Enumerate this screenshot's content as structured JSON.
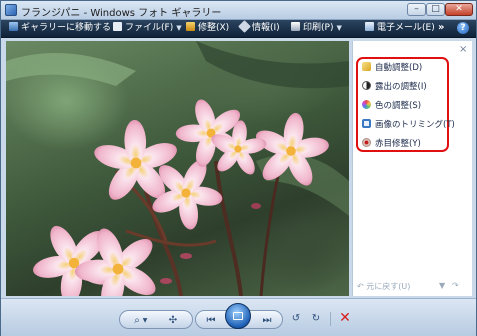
{
  "window": {
    "title": "フランジパニ - Windows フォト ギャラリー",
    "controls": {
      "minimize": "–",
      "maximize": "□",
      "close": "✕"
    }
  },
  "toolbar": {
    "items": [
      {
        "label": "ギャラリーに移動する",
        "icon": "gallery-icon"
      },
      {
        "label": "ファイル(F)",
        "icon": "file-icon",
        "has_menu": true
      },
      {
        "label": "修整(X)",
        "icon": "fix-icon"
      },
      {
        "label": "情報(I)",
        "icon": "info-tag-icon"
      },
      {
        "label": "印刷(P)",
        "icon": "print-icon",
        "has_menu": true
      },
      {
        "label": "電子メール(E)",
        "icon": "email-icon"
      }
    ],
    "more": "»",
    "help": "?"
  },
  "fix_panel": {
    "close": "×",
    "items": [
      {
        "label": "自動調整(D)",
        "icon": "auto-adjust-icon",
        "color": "#d9a421"
      },
      {
        "label": "露出の調整(I)",
        "icon": "exposure-icon",
        "color": "#333333"
      },
      {
        "label": "色の調整(S)",
        "icon": "color-icon",
        "color": "#d94a8c"
      },
      {
        "label": "画像のトリミング(T)",
        "icon": "crop-icon",
        "color": "#3a78c4"
      },
      {
        "label": "赤目修整(Y)",
        "icon": "red-eye-icon",
        "color": "#7a3a3a"
      }
    ],
    "undo": "元に戻す(U)",
    "redo_arrow": "↷"
  },
  "bottom_controls": {
    "zoom": "⌕",
    "fit": "✣",
    "previous": "⏮",
    "slideshow": "",
    "next": "⏭",
    "rotate_ccw": "↺",
    "rotate_cw": "↻",
    "delete": "✕"
  },
  "colors": {
    "highlight_border": "#e01010",
    "toolbar_bg": "#1a2e48",
    "accent": "#1d5fb5"
  }
}
